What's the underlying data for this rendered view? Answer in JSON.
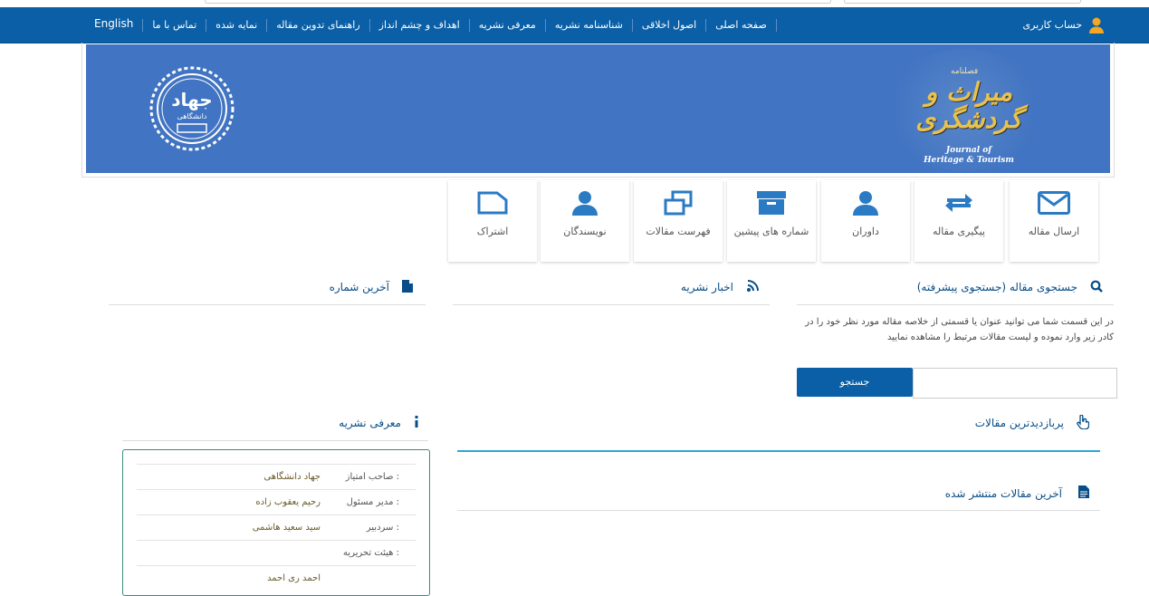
{
  "nav": {
    "english": "English",
    "items": [
      "تماس با ما",
      "نمایه شده",
      "راهنمای تدوین مقاله",
      "اهداف و چشم انداز",
      "معرفی نشریه",
      "شناسنامه نشریه",
      "اصول اخلاقی",
      "صفحه اصلی"
    ],
    "account": "حساب کاربری"
  },
  "banner": {
    "title_fa": "میراث و گردشگری",
    "subtitle_fa": "فصلنامه",
    "title_en_line1": "Journal of",
    "title_en_line2": "Heritage & Tourism",
    "seal_text": "جهاد",
    "seal_sub": "دانشگاهی"
  },
  "tiles": [
    {
      "label": "ارسال مقاله",
      "icon": "envelope-icon"
    },
    {
      "label": "پیگیری مقاله",
      "icon": "exchange-arrows-icon"
    },
    {
      "label": "داوران",
      "icon": "user-icon"
    },
    {
      "label": "شماره های پیشین",
      "icon": "archive-box-icon"
    },
    {
      "label": "فهرست مقالات",
      "icon": "windows-stack-icon"
    },
    {
      "label": "نویسندگان",
      "icon": "user-icon"
    },
    {
      "label": "اشتراک",
      "icon": "folder-icon"
    }
  ],
  "search": {
    "heading": "جستجوی مقاله (جستجوی پیشرفته)",
    "description": "در این قسمت شما می توانید عنوان یا قسمتی از خلاصه مقاله مورد نظر خود را در کادر زیر وارد نموده و لیست مقالات مرتبط را مشاهده نمایید",
    "button": "جستجو",
    "input_value": ""
  },
  "news": {
    "heading": "اخبار نشریه"
  },
  "latest_issue": {
    "heading": "آخرین شماره"
  },
  "most_viewed": {
    "heading": "پربازدیدترین مقالات"
  },
  "latest_articles": {
    "heading": "آخرین مقالات منتشر شده"
  },
  "about": {
    "heading": "معرفی نشریه",
    "rows": [
      {
        "key": "صاحب امتیاز :",
        "value": "جهاد دانشگاهی"
      },
      {
        "key": "مدیر مسئول :",
        "value": "رحیم یعقوب زاده"
      },
      {
        "key": "سردبیر :",
        "value": "سید سعید هاشمی"
      },
      {
        "key": "هیئت تحریریه :",
        "value": ""
      },
      {
        "key": "",
        "value": "احمد رى احمد"
      }
    ]
  },
  "colors": {
    "nav": "#0a5fa6",
    "banner": "#4174c2",
    "accent": "#2ea6d6"
  }
}
